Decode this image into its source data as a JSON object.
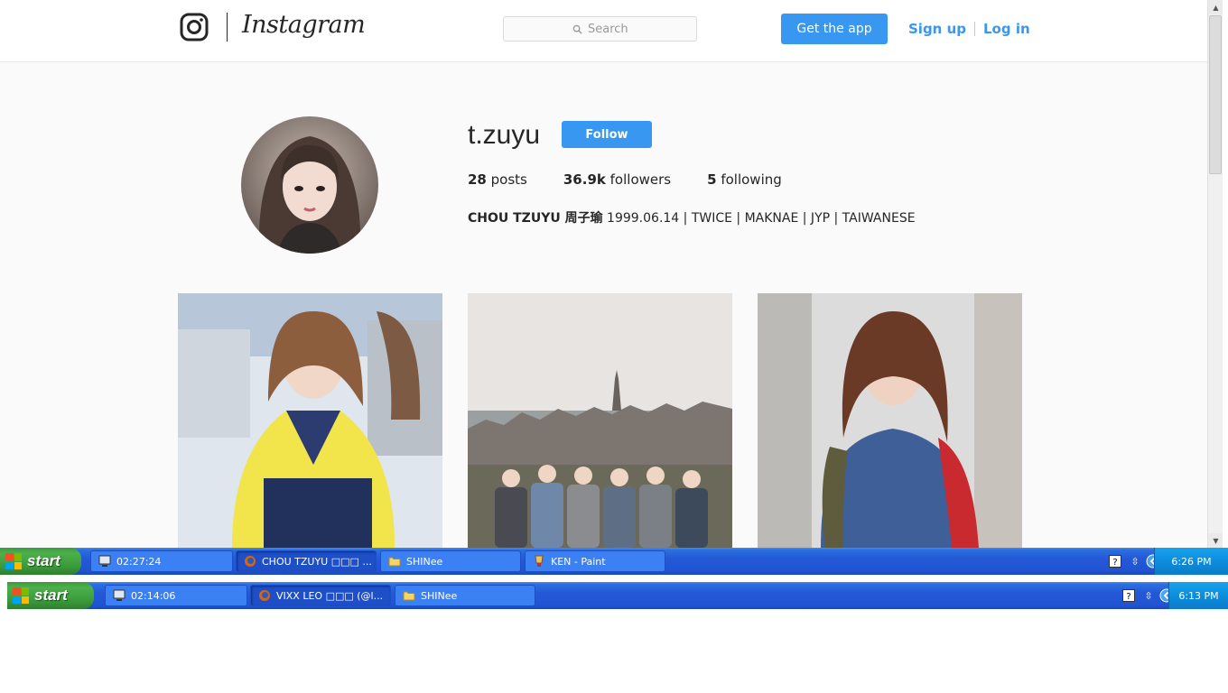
{
  "instagram": {
    "wordmark": "Instagram",
    "search_placeholder": "Search",
    "get_app_label": "Get the app",
    "sign_up_label": "Sign up",
    "log_in_label": "Log in"
  },
  "profile": {
    "username": "t.zuyu",
    "follow_label": "Follow",
    "posts_count": "28",
    "posts_label": "posts",
    "followers_count": "36.9k",
    "followers_label": "followers",
    "following_count": "5",
    "following_label": "following",
    "bio_name": "CHOU TZUYU 周子瑜",
    "bio_text": "1999.06.14 | TWICE | MAKNAE | JYP | TAIWANESE"
  },
  "posts": [
    {
      "icon": "photo-girl-yellow-sweater"
    },
    {
      "icon": "photo-group-city-view"
    },
    {
      "icon": "photo-girl-sport-jacket"
    }
  ],
  "taskbar_top": {
    "start_label": "start",
    "tasks": [
      {
        "label": "02:27:24",
        "icon": "timer-icon"
      },
      {
        "label": "CHOU TZUYU □□□ ...",
        "icon": "firefox-icon"
      },
      {
        "label": "SHINee",
        "icon": "folder-icon"
      },
      {
        "label": "KEN - Paint",
        "icon": "paint-icon"
      }
    ],
    "clock": "6:26 PM"
  },
  "taskbar_bottom": {
    "start_label": "start",
    "tasks": [
      {
        "label": "02:14:06",
        "icon": "timer-icon"
      },
      {
        "label": "VIXX LEO □□□ (@l...",
        "icon": "firefox-icon"
      },
      {
        "label": "SHINee",
        "icon": "folder-icon"
      }
    ],
    "clock": "6:13 PM"
  },
  "colors": {
    "accent": "#3897f0",
    "taskbar": "#2458d6",
    "start_green": "#3a9a3a"
  }
}
